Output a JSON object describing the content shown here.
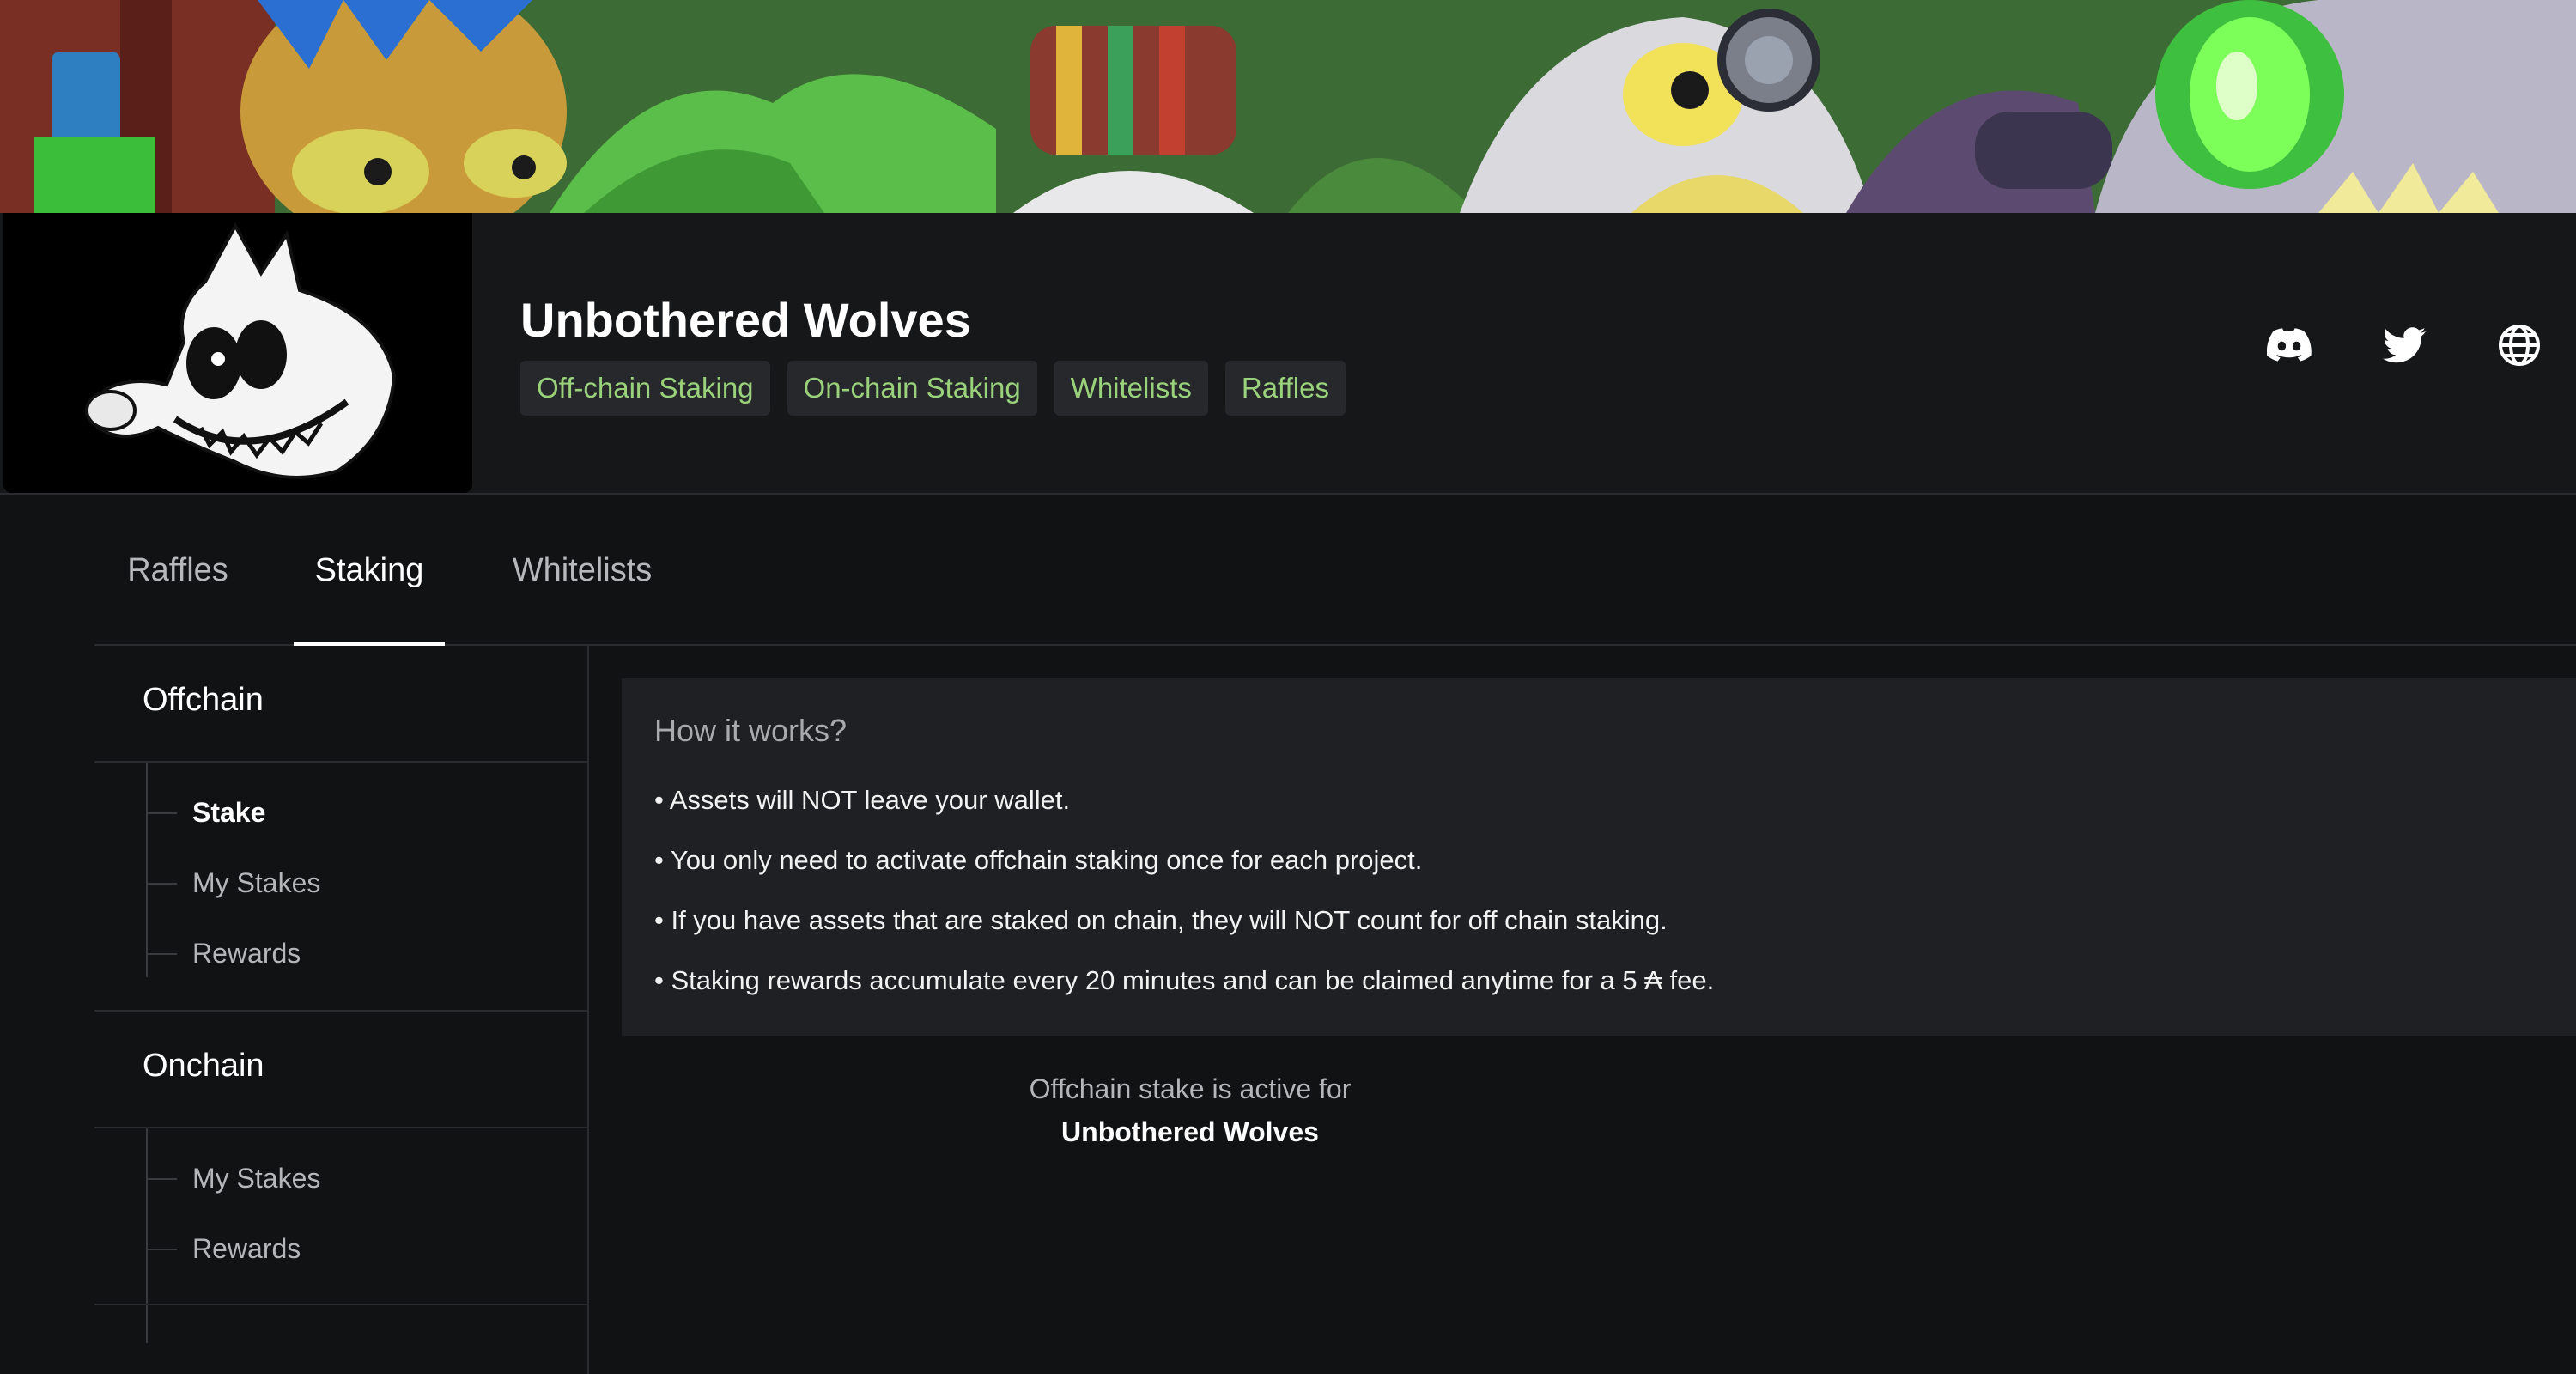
{
  "header": {
    "project_name": "Unbothered Wolves",
    "tags": [
      "Off-chain Staking",
      "On-chain Staking",
      "Whitelists",
      "Raffles"
    ],
    "socials": [
      "discord-icon",
      "twitter-icon",
      "globe-icon"
    ]
  },
  "tabs": {
    "items": [
      "Raffles",
      "Staking",
      "Whitelists"
    ],
    "active": "Staking"
  },
  "sidebar": {
    "offchain": {
      "title": "Offchain",
      "items": [
        "Stake",
        "My Stakes",
        "Rewards"
      ],
      "active": "Stake"
    },
    "onchain": {
      "title": "Onchain",
      "items": [
        "My Stakes",
        "Rewards"
      ]
    }
  },
  "info": {
    "title": "How it works?",
    "bullets": [
      "• Assets will NOT leave your wallet.",
      "• You only need to activate offchain staking once for each project.",
      "• If you have assets that are staked on chain, they will NOT count for off chain staking.",
      "• Staking rewards accumulate every 20 minutes and can be claimed anytime for a 5 ₳ fee."
    ]
  },
  "status": {
    "text": "Offchain stake is active for",
    "project": "Unbothered Wolves"
  },
  "colors": {
    "background": "#111214",
    "panel": "#1f2023",
    "tag_text": "#9ad27c",
    "tag_bg": "#26282b"
  }
}
